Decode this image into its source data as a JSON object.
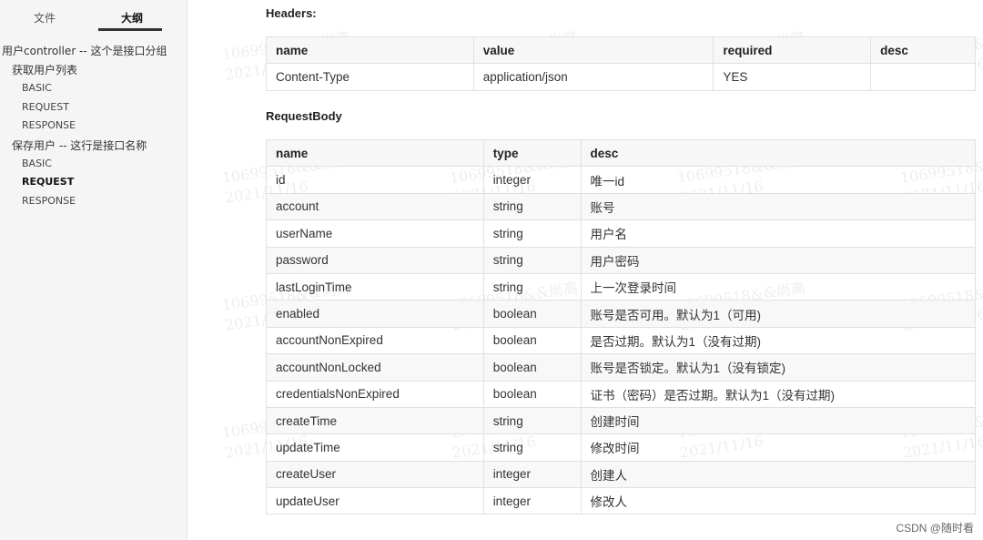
{
  "sidebar": {
    "tabs": [
      {
        "label": "文件"
      },
      {
        "label": "大纲"
      }
    ],
    "outline": [
      {
        "label": "用户controller -- 这个是接口分组"
      },
      {
        "label": "获取用户列表"
      },
      {
        "label": "BASIC"
      },
      {
        "label": "REQUEST"
      },
      {
        "label": "RESPONSE"
      },
      {
        "label": "保存用户 -- 这行是接口名称"
      },
      {
        "label": "BASIC"
      },
      {
        "label": "REQUEST"
      },
      {
        "label": "RESPONSE"
      }
    ]
  },
  "headers": {
    "title": "Headers:",
    "columns": [
      "name",
      "value",
      "required",
      "desc"
    ],
    "rows": [
      [
        "Content-Type",
        "application/json",
        "YES",
        ""
      ]
    ]
  },
  "request_body": {
    "title": "RequestBody",
    "columns": [
      "name",
      "type",
      "desc"
    ],
    "rows": [
      [
        "id",
        "integer",
        "唯一id"
      ],
      [
        "account",
        "string",
        "账号"
      ],
      [
        "userName",
        "string",
        "用户名"
      ],
      [
        "password",
        "string",
        "用户密码"
      ],
      [
        "lastLoginTime",
        "string",
        "上一次登录时间"
      ],
      [
        "enabled",
        "boolean",
        "账号是否可用。默认为1（可用)"
      ],
      [
        "accountNonExpired",
        "boolean",
        "是否过期。默认为1（没有过期)"
      ],
      [
        "accountNonLocked",
        "boolean",
        "账号是否锁定。默认为1（没有锁定)"
      ],
      [
        "credentialsNonExpired",
        "boolean",
        "证书（密码）是否过期。默认为1（没有过期)"
      ],
      [
        "createTime",
        "string",
        "创建时间"
      ],
      [
        "updateTime",
        "string",
        "修改时间"
      ],
      [
        "createUser",
        "integer",
        "创建人"
      ],
      [
        "updateUser",
        "integer",
        "修改人"
      ]
    ]
  },
  "watermark": {
    "line1": "10699518&&尚高",
    "line2": "2021/11/16"
  },
  "credit": "CSDN @随时看"
}
